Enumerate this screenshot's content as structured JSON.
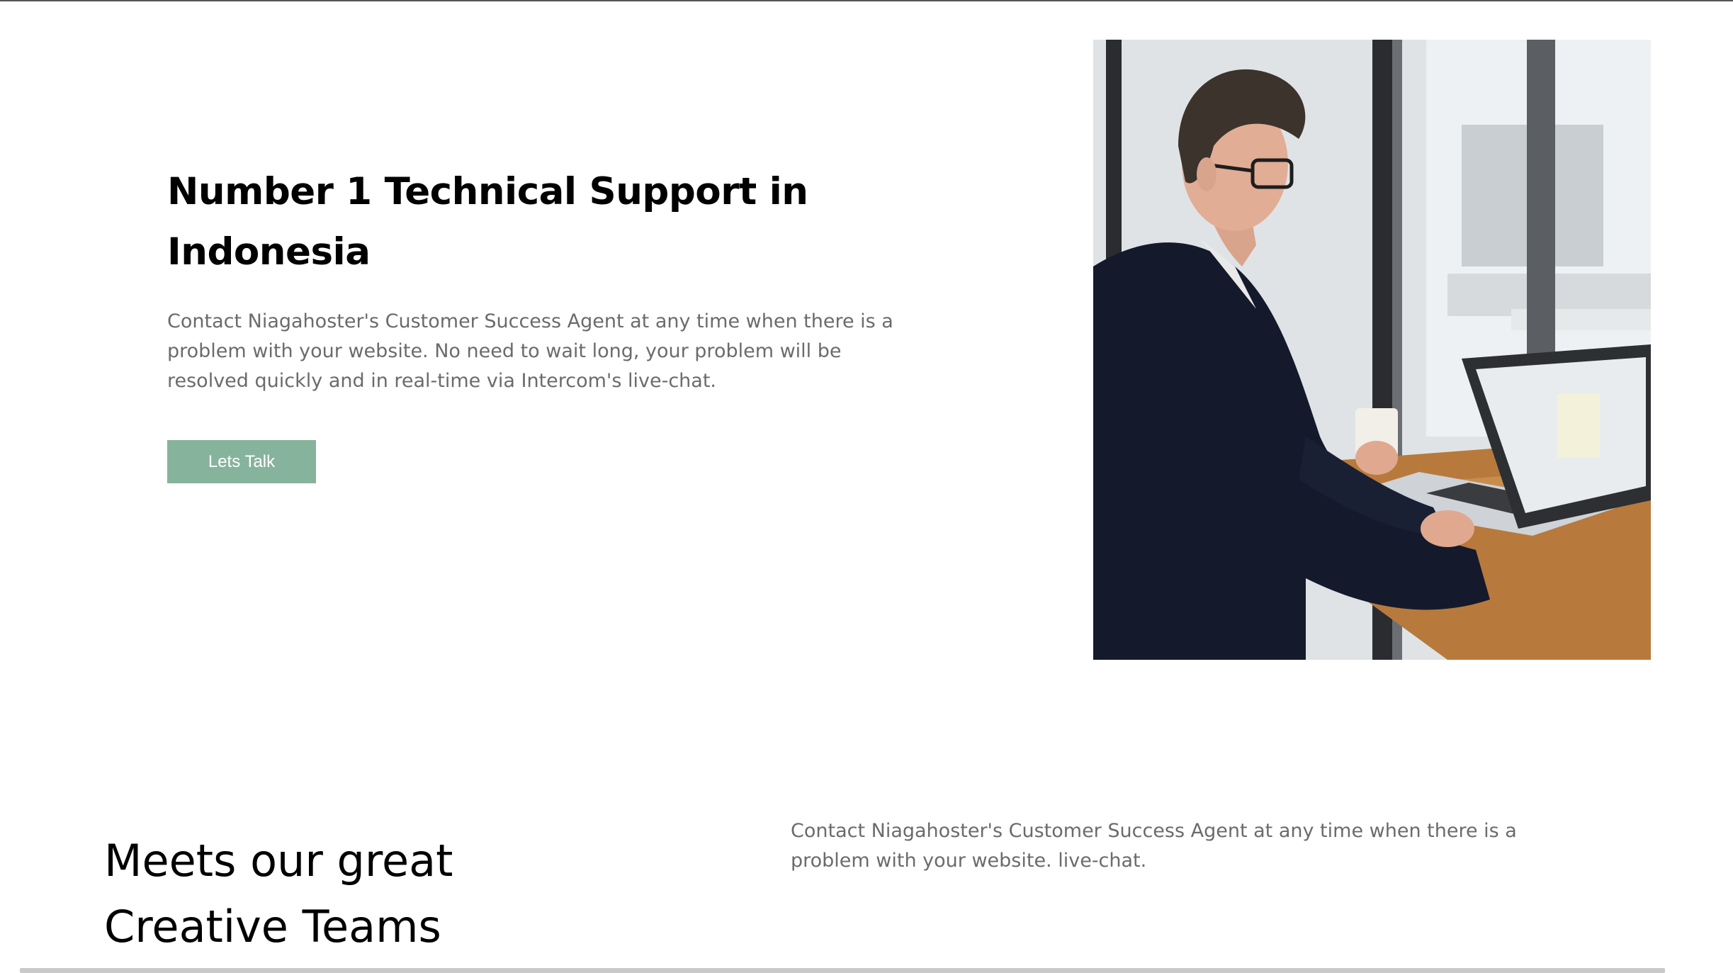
{
  "hero": {
    "title": "Number 1 Technical Support in Indonesia",
    "description": "Contact Niagahoster's Customer Success Agent at any time when there is a problem with your website. No need to wait long, your problem will be resolved quickly and in real-time via Intercom's live-chat.",
    "cta_label": "Lets Talk",
    "image_subject": "man-working-on-laptop-photo"
  },
  "team": {
    "title": "Meets our great Creative Teams",
    "description": "Contact Niagahoster's Customer Success Agent at any time when there is a problem with your website. live-chat."
  },
  "colors": {
    "cta_background": "#86b39c",
    "body_text": "#6b6b6b",
    "heading_text": "#000000"
  }
}
